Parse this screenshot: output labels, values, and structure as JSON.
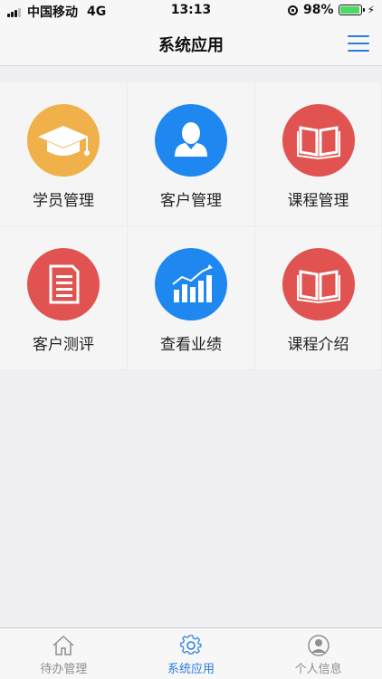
{
  "status_bar": {
    "carrier": "中国移动",
    "network": "4G",
    "time": "13:13",
    "battery_percent_text": "98%",
    "battery_level": 0.98,
    "battery_color": "#4cd964"
  },
  "nav": {
    "title": "系统应用",
    "menu_icon": "hamburger-menu-icon",
    "accent_color": "#2c7fd6"
  },
  "apps": [
    {
      "label": "学员管理",
      "icon": "graduation-cap-icon",
      "color": "#f0b04a"
    },
    {
      "label": "客户管理",
      "icon": "person-icon",
      "color": "#1e88f0"
    },
    {
      "label": "课程管理",
      "icon": "open-book-icon",
      "color": "#e05350"
    },
    {
      "label": "客户测评",
      "icon": "document-icon",
      "color": "#e05350"
    },
    {
      "label": "查看业绩",
      "icon": "bar-chart-trend-icon",
      "color": "#1e88f0"
    },
    {
      "label": "课程介绍",
      "icon": "open-book-icon",
      "color": "#e05350"
    }
  ],
  "tab_bar": {
    "tabs": [
      {
        "label": "待办管理",
        "icon": "home-icon",
        "active": false
      },
      {
        "label": "系统应用",
        "icon": "gear-icon",
        "active": true
      },
      {
        "label": "个人信息",
        "icon": "user-avatar-icon",
        "active": false
      }
    ],
    "active_color": "#2a7de1",
    "inactive_color": "#8e8e93"
  }
}
